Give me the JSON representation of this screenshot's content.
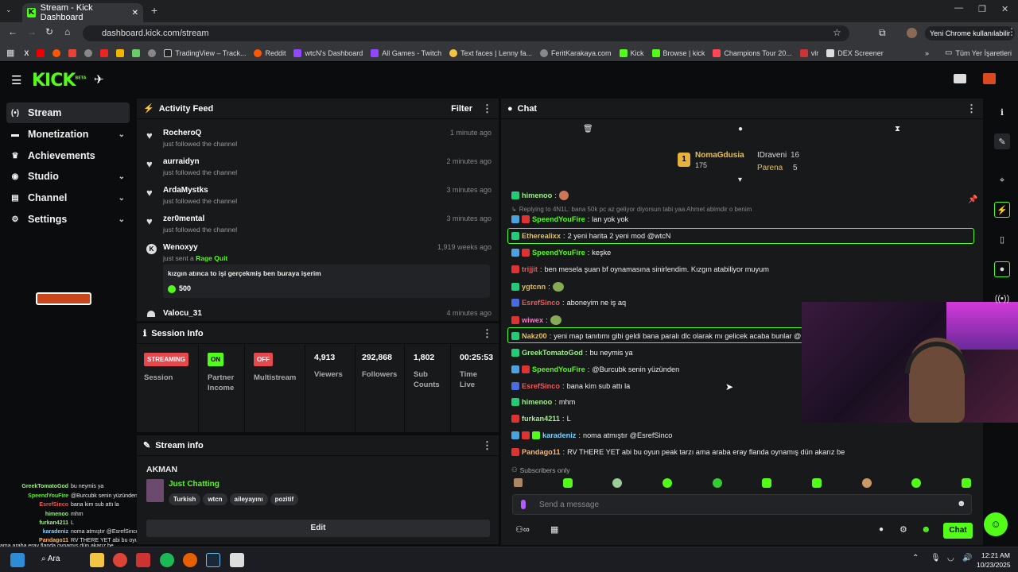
{
  "browser": {
    "tab_title": "Stream - Kick Dashboard",
    "url": "dashboard.kick.com/stream",
    "profile_label": "Yeni Chrome kullanılabilir",
    "bookmarks": [
      "TradingView – Track...",
      "Reddit",
      "wtcN's Dashboard",
      "All Games - Twitch",
      "Text faces | Lenny fa...",
      "FeritKarakaya.com",
      "Kick",
      "Browse | kick",
      "Champions Tour 20...",
      "vlr",
      "DEX Screener"
    ],
    "all_bookmarks": "Tüm Yer İşaretleri"
  },
  "header": {
    "logo": "KICK",
    "beta": "BETA"
  },
  "sidebar": {
    "items": [
      {
        "label": "Stream"
      },
      {
        "label": "Monetization"
      },
      {
        "label": "Achievements"
      },
      {
        "label": "Studio"
      },
      {
        "label": "Channel"
      },
      {
        "label": "Settings"
      }
    ]
  },
  "activity": {
    "title": "Activity Feed",
    "filter": "Filter",
    "items": [
      {
        "name": "RocheroQ",
        "action": "just followed the channel",
        "time": "1 minute ago"
      },
      {
        "name": "aurraidyn",
        "action": "just followed the channel",
        "time": "2 minutes ago"
      },
      {
        "name": "ArdaMystks",
        "action": "just followed the channel",
        "time": "3 minutes ago"
      },
      {
        "name": "zer0mental",
        "action": "just followed the channel",
        "time": "3 minutes ago"
      },
      {
        "name": "Wenoxyy",
        "action": "just sent a",
        "gift": "Rage Quit",
        "time": "1,919 weeks ago",
        "message": "kızgın atınca to işi gerçekmiş ben buraya işerim",
        "amount": "500"
      },
      {
        "name": "Valocu_31",
        "time": "4 minutes ago"
      }
    ]
  },
  "session": {
    "title": "Session Info",
    "streaming": "STREAMING",
    "session_label": "Session",
    "on": "ON",
    "partner_label": "Partner Income",
    "off": "OFF",
    "multistream_label": "Multistream",
    "viewers": "4,913",
    "viewers_label": "Viewers",
    "followers": "292,868",
    "followers_label": "Followers",
    "subs": "1,802",
    "subs_label": "Sub Counts",
    "time": "00:25:53",
    "time_label": "Time Live"
  },
  "streaminfo": {
    "title": "Stream info",
    "stream_title": "AKMAN",
    "category": "Just Chatting",
    "tags": [
      "Turkish",
      "wtcn",
      "aileyayını",
      "pozitif"
    ],
    "edit": "Edit"
  },
  "chat": {
    "title": "Chat",
    "top": [
      {
        "rank": "1",
        "name": "NomaGdusia",
        "count": "175"
      },
      {
        "name": "IDraveni",
        "count": "16"
      },
      {
        "name": "Parena",
        "count": "5"
      }
    ],
    "reply_note": "Replying to 4N1L: bana 50k pc az geliyor diyorsun tabi yaa Ahmet abimdir o benim",
    "messages": [
      {
        "user": "himenoo",
        "text": "",
        "color": "#9fef8a"
      },
      {
        "user": "SpeendYouFire",
        "text": "lan yok yok",
        "color": "#53fc18"
      },
      {
        "user": "Etherealixx",
        "text": "2 yeni harita 2 yeni mod @wtcN",
        "color": "#e8c14a"
      },
      {
        "user": "SpeendYouFire",
        "text": "keşke",
        "color": "#53fc18"
      },
      {
        "user": "trijjit",
        "text": "ben mesela şuan bf oynamasına sinirlendim. Kızgın atabiliyor muyum",
        "color": "#e55b5b"
      },
      {
        "user": "ygtcnn",
        "text": "",
        "color": "#e8c14a"
      },
      {
        "user": "EsrefSinco",
        "text": "aboneyim ne iş aq",
        "color": "#e55b5b"
      },
      {
        "user": "wiwex",
        "text": "",
        "color": "#ff6fcf"
      },
      {
        "user": "Nakz00",
        "text": "yeni map tanıtımı gibi geldi bana paralı dlc olarak mı gelicek acaba bunlar @",
        "color": "#e8c14a"
      },
      {
        "user": "GreekTomatoGod",
        "text": "bu neymis ya",
        "color": "#9fef8a"
      },
      {
        "user": "SpeendYouFire",
        "text": "@Burcubk senin yüzünden",
        "color": "#53fc18"
      },
      {
        "user": "EsrefSinco",
        "text": "bana kim sub attı la",
        "color": "#e55b5b"
      },
      {
        "user": "himenoo",
        "text": "mhm",
        "color": "#9fef8a"
      },
      {
        "user": "furkan4211",
        "text": "L",
        "color": "#9fef8a"
      },
      {
        "user": "karadeniz",
        "text": "noma atmıştır @EsrefSinco",
        "color": "#7dd3ff"
      },
      {
        "user": "Pandago11",
        "text": "RV THERE YET abi bu oyun peak tarzı ama araba eray flanda oynamış dün akarız be",
        "color": "#ffb36b"
      }
    ],
    "subs_only": "Subscribers only",
    "placeholder": "Send a message",
    "send": "Chat"
  },
  "overlay": [
    {
      "user": "GreekTomatoGod",
      "text": "bu neymis ya",
      "color": "#9fef8a"
    },
    {
      "user": "SpeendYouFire",
      "text": "@Burcubk senin yüzünden",
      "color": "#53fc18"
    },
    {
      "user": "EsrefSinco",
      "text": "bana kim sub attı la",
      "color": "#e55b5b"
    },
    {
      "user": "himenoo",
      "text": "mhm",
      "color": "#9fef8a"
    },
    {
      "user": "furkan4211",
      "text": "L",
      "color": "#9fef8a"
    },
    {
      "user": "karadeniz",
      "text": "noma atmıştır @EsrefSinco",
      "color": "#7dd3ff"
    },
    {
      "user": "Pandago11",
      "text": "RV THERE YET abi bu oyun peak tarzı ama araba eray flanda oynamış dün akarız be",
      "color": "#ffb36b"
    }
  ],
  "taskbar": {
    "search": "Ara",
    "time": "12:21 AM",
    "date": "10/23/2025"
  },
  "colors": {
    "accent": "#53fc18",
    "panel": "#18191b",
    "bg": "#0b0c0d"
  }
}
